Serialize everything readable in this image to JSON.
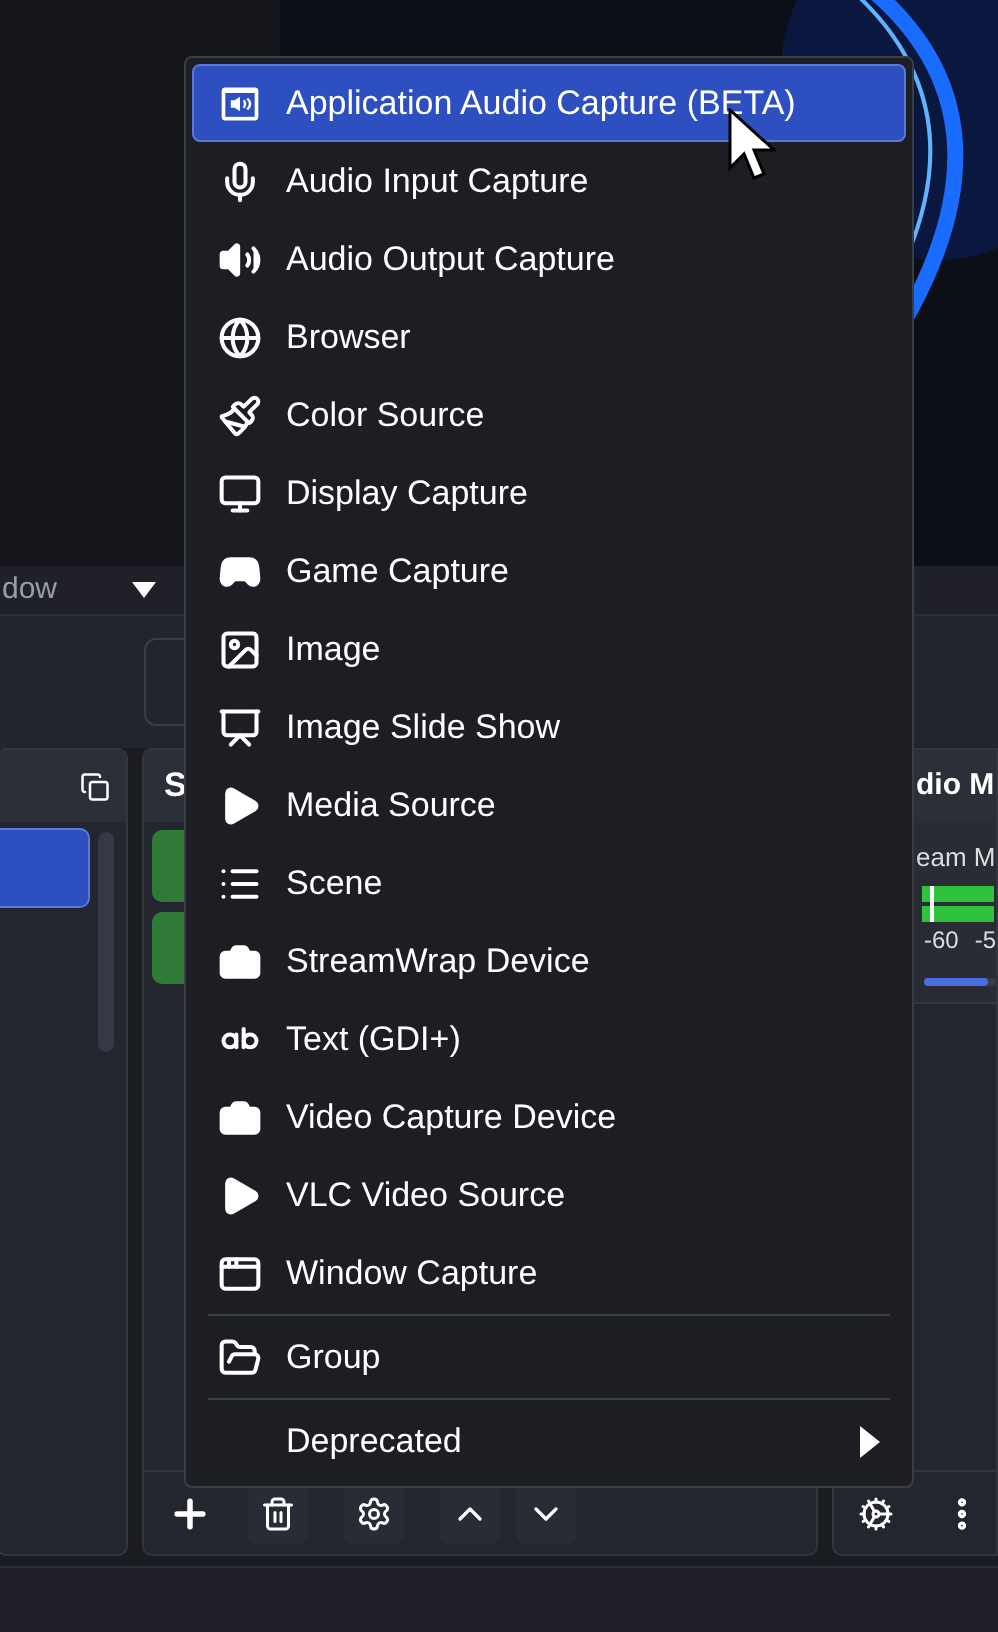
{
  "scene_bar": {
    "text": "dow"
  },
  "scenes": {
    "items": [
      {
        "selected": true
      }
    ]
  },
  "sources": {
    "title": "S"
  },
  "audio_mixer": {
    "title": "dio M",
    "channels": [
      {
        "name": "eam M",
        "ticks": [
          "-60",
          "-5"
        ],
        "level": 0.9
      }
    ]
  },
  "menu": {
    "items": [
      {
        "kind": "item",
        "label": "Application Audio Capture (BETA)",
        "selected": true
      },
      {
        "kind": "item",
        "label": "Audio Input Capture",
        "selected": false
      },
      {
        "kind": "item",
        "label": "Audio Output Capture",
        "selected": false
      },
      {
        "kind": "item",
        "label": "Browser",
        "selected": false
      },
      {
        "kind": "item",
        "label": "Color Source",
        "selected": false
      },
      {
        "kind": "item",
        "label": "Display Capture",
        "selected": false
      },
      {
        "kind": "item",
        "label": "Game Capture",
        "selected": false
      },
      {
        "kind": "item",
        "label": "Image",
        "selected": false
      },
      {
        "kind": "item",
        "label": "Image Slide Show",
        "selected": false
      },
      {
        "kind": "item",
        "label": "Media Source",
        "selected": false
      },
      {
        "kind": "item",
        "label": "Scene",
        "selected": false
      },
      {
        "kind": "item",
        "label": "StreamWrap Device",
        "selected": false
      },
      {
        "kind": "item",
        "label": "Text (GDI+)",
        "selected": false
      },
      {
        "kind": "item",
        "label": "Video Capture Device",
        "selected": false
      },
      {
        "kind": "item",
        "label": "VLC Video Source",
        "selected": false
      },
      {
        "kind": "item",
        "label": "Window Capture",
        "selected": false
      },
      {
        "kind": "separator"
      },
      {
        "kind": "item",
        "label": "Group",
        "selected": false
      },
      {
        "kind": "separator"
      },
      {
        "kind": "submenu",
        "label": "Deprecated",
        "selected": false
      }
    ]
  }
}
